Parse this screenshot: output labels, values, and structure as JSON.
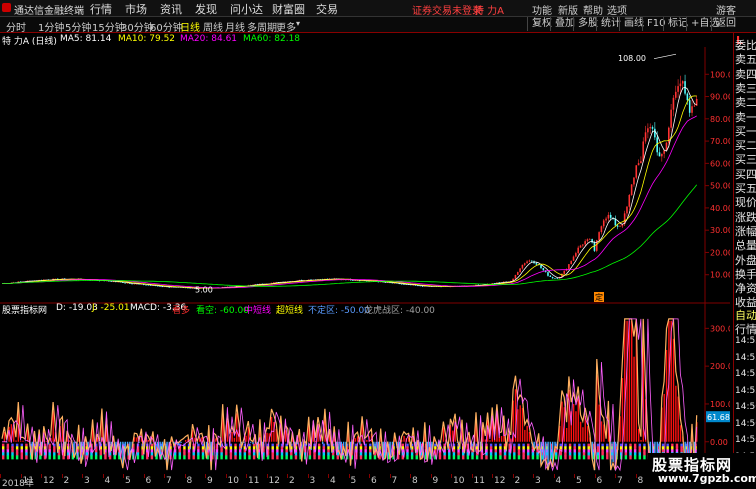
{
  "app": {
    "title": "通达信金融终端",
    "menu": [
      "行情",
      "市场",
      "资讯",
      "发现",
      "问小达",
      "财富圈",
      "交易"
    ],
    "status_warning": "证券交易未登录",
    "stock_tab": "特 力A",
    "right_menu": [
      "功能",
      "新版",
      "帮助",
      "选项",
      "游客"
    ]
  },
  "toolbar": {
    "periods": [
      "分时",
      "1分钟",
      "5分钟",
      "15分钟",
      "30分钟",
      "60分钟",
      "日线",
      "周线",
      "月线",
      "多周期",
      "更多"
    ],
    "active_period": "日线",
    "buttons": [
      "复权",
      "叠加",
      "多股",
      "统计",
      "画线",
      "F10",
      "标记",
      "+自选",
      "返回"
    ]
  },
  "info": {
    "stock_label": "特 力A (日线)",
    "ma5": "MA5: 81.14",
    "ma10": "MA10: 79.52",
    "ma20": "MA20: 84.61",
    "ma60": "MA60: 82.18"
  },
  "indicator": {
    "name": "股票指标网",
    "d": "D: -19.03",
    "j": "J: -25.01",
    "macd": "MACD: -3.36",
    "kanduo": "看多",
    "kankong": "看空: -60.00",
    "zhongduan": "中短线",
    "chaoduan": "超短线",
    "budingqu": "不定区: -50.00",
    "longhu": "龙虎战区: -40.00"
  },
  "colors": {
    "up": "#ff3232",
    "down": "#54ffff",
    "ma5": "#ffffff",
    "ma10": "#ffff00",
    "ma20": "#ff00ff",
    "ma60": "#00ff00",
    "grid": "#800000"
  },
  "chart_data": {
    "type": "line",
    "price_axis": [
      "100.0",
      "90.00",
      "80.00",
      "70.00",
      "60.00",
      "50.00",
      "40.00",
      "30.00",
      "20.00",
      "10.00"
    ],
    "ind_axis": [
      "300.0",
      "200.0",
      "100.0",
      "0.00"
    ],
    "high_label": "108.00",
    "low_label": "5.00",
    "current_value": "61.68",
    "ding_label": "定",
    "x_axis_labels": [
      "2018年",
      "11",
      "12",
      "2",
      "3",
      "4",
      "5",
      "6",
      "7",
      "8",
      "9",
      "10",
      "11",
      "12",
      "2",
      "3",
      "4",
      "5",
      "6",
      "7",
      "8",
      "9",
      "10",
      "11",
      "12",
      "2",
      "3",
      "4",
      "5",
      "6",
      "7",
      "8",
      "9",
      "10"
    ]
  },
  "right_panel": {
    "top_label": "L",
    "items": [
      "委比",
      "卖五",
      "卖四",
      "卖三",
      "卖二",
      "卖一",
      "买一",
      "买二",
      "买三",
      "买四",
      "买五",
      "现价",
      "涨跌",
      "涨幅",
      "总量",
      "外盘",
      "换手",
      "净资",
      "收益"
    ],
    "items2": [
      "自动",
      "行情"
    ],
    "times": [
      "14:55",
      "14:55",
      "14:55",
      "14:55",
      "14:56",
      "14:56",
      "14:56",
      "14:56"
    ]
  },
  "watermark": {
    "line1": "股票指标网",
    "line2": "www.7gpzb.com"
  }
}
